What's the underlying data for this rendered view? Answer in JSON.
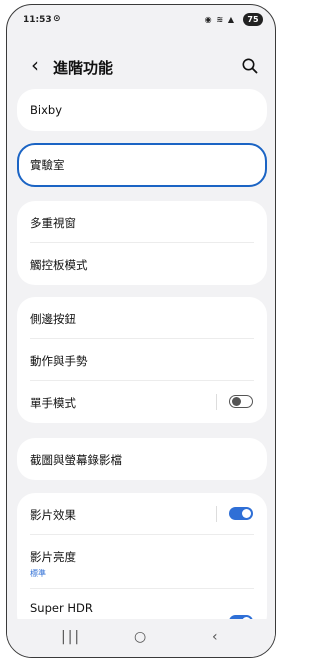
{
  "status_bar": {
    "time": "11:53",
    "battery": "75"
  },
  "header": {
    "title": "進階功能"
  },
  "sections": [
    {
      "items": [
        {
          "label": "Bixby"
        }
      ]
    },
    {
      "items": [
        {
          "label": "實驗室"
        }
      ]
    },
    {
      "items": [
        {
          "label": "多重視窗"
        },
        {
          "label": "觸控板模式"
        }
      ]
    },
    {
      "items": [
        {
          "label": "側邊按鈕"
        },
        {
          "label": "動作與手勢"
        },
        {
          "label": "單手模式",
          "toggle": "off"
        }
      ]
    },
    {
      "items": [
        {
          "label": "截圖與螢幕錄影檔"
        }
      ]
    },
    {
      "items": [
        {
          "label": "影片效果",
          "toggle": "on"
        },
        {
          "label": "影片亮度",
          "sublabel": "標準"
        },
        {
          "label": "Super HDR",
          "toggle": "on"
        }
      ]
    }
  ],
  "colors": {
    "accent": "#2f6fd6",
    "selection_border": "#1b64c4",
    "background": "#f2f2f4"
  },
  "icons": {
    "back": "chevron-left-icon",
    "search": "search-icon",
    "recents": "recents-icon",
    "home": "home-icon",
    "nav_back": "nav-back-icon"
  }
}
